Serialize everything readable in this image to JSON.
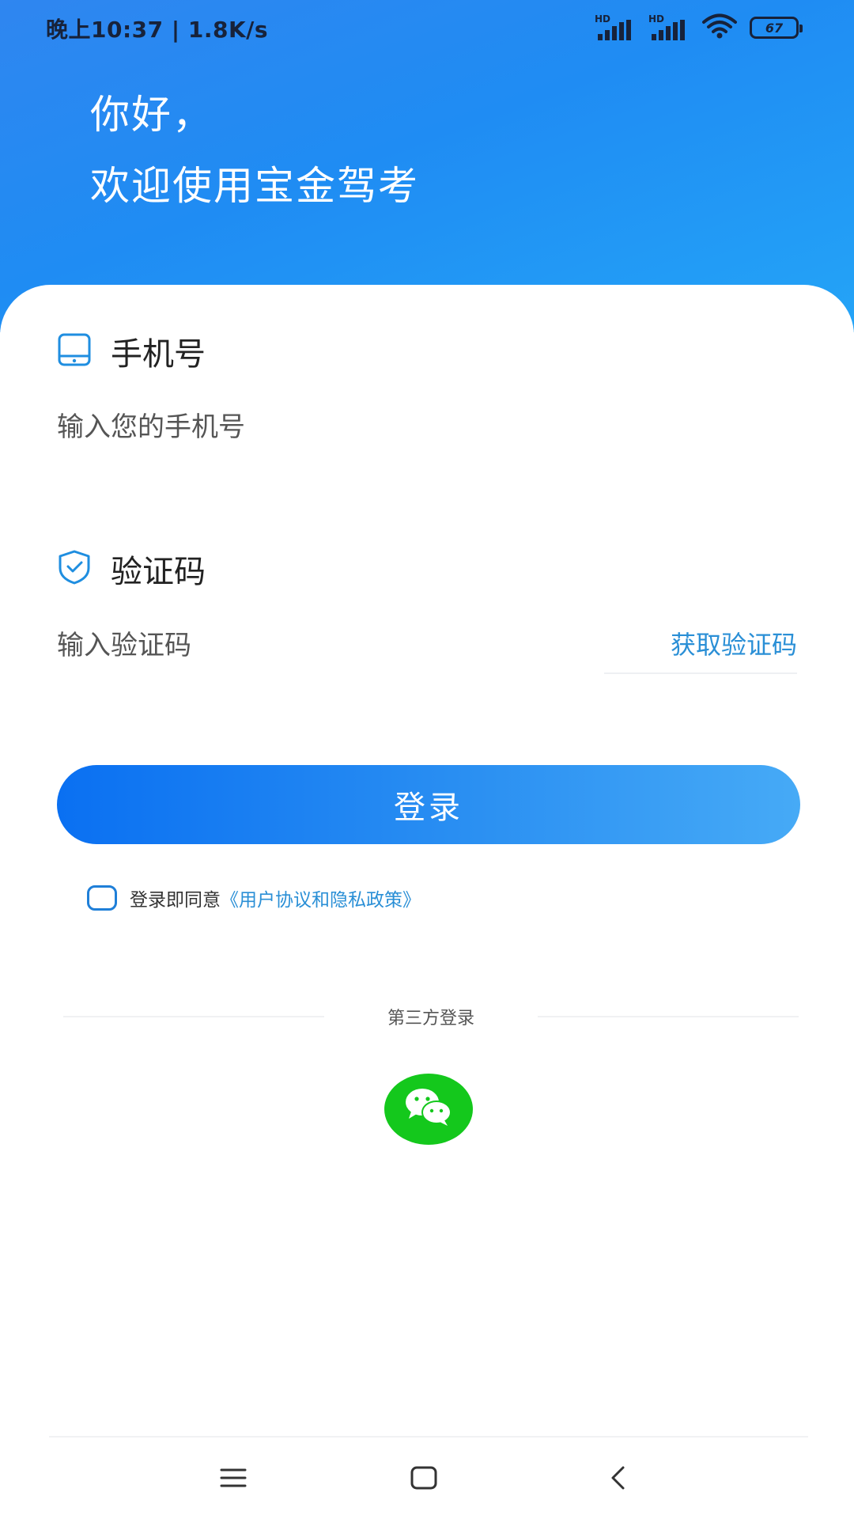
{
  "status_bar": {
    "time_speed": "晚上10:37 | 1.8K/s",
    "signal_1_label": "HD",
    "signal_2_label": "HD",
    "battery": "67",
    "icons": [
      "signal-icon",
      "signal-icon",
      "wifi-icon",
      "battery-icon"
    ]
  },
  "header": {
    "greeting_line1": "你好，",
    "greeting_line2": "欢迎使用宝金驾考",
    "gradient_colors": [
      "#2f86f0",
      "#24a4f7"
    ]
  },
  "phone_field": {
    "icon": "phone-icon",
    "label": "手机号",
    "value": "",
    "placeholder": "输入您的手机号"
  },
  "code_field": {
    "icon": "shield-check-icon",
    "label": "验证码",
    "value": "",
    "placeholder": "输入验证码",
    "get_code_label": "获取验证码"
  },
  "login_button": {
    "label": "登录",
    "colors": [
      "#0a70f2",
      "#46aaf6"
    ]
  },
  "agreement": {
    "checked": false,
    "text": "登录即同意",
    "link": "《用户协议和隐私政策》"
  },
  "third_party": {
    "label": "第三方登录",
    "wechat_icon": "wechat-icon",
    "wechat_color": "#14c81c"
  },
  "nav_bar": {
    "icons": [
      "menu-icon",
      "home-square-icon",
      "back-chevron-icon"
    ]
  },
  "colors": {
    "accent": "#2a8fd6",
    "label_text": "#222222",
    "placeholder_text": "#555555"
  }
}
